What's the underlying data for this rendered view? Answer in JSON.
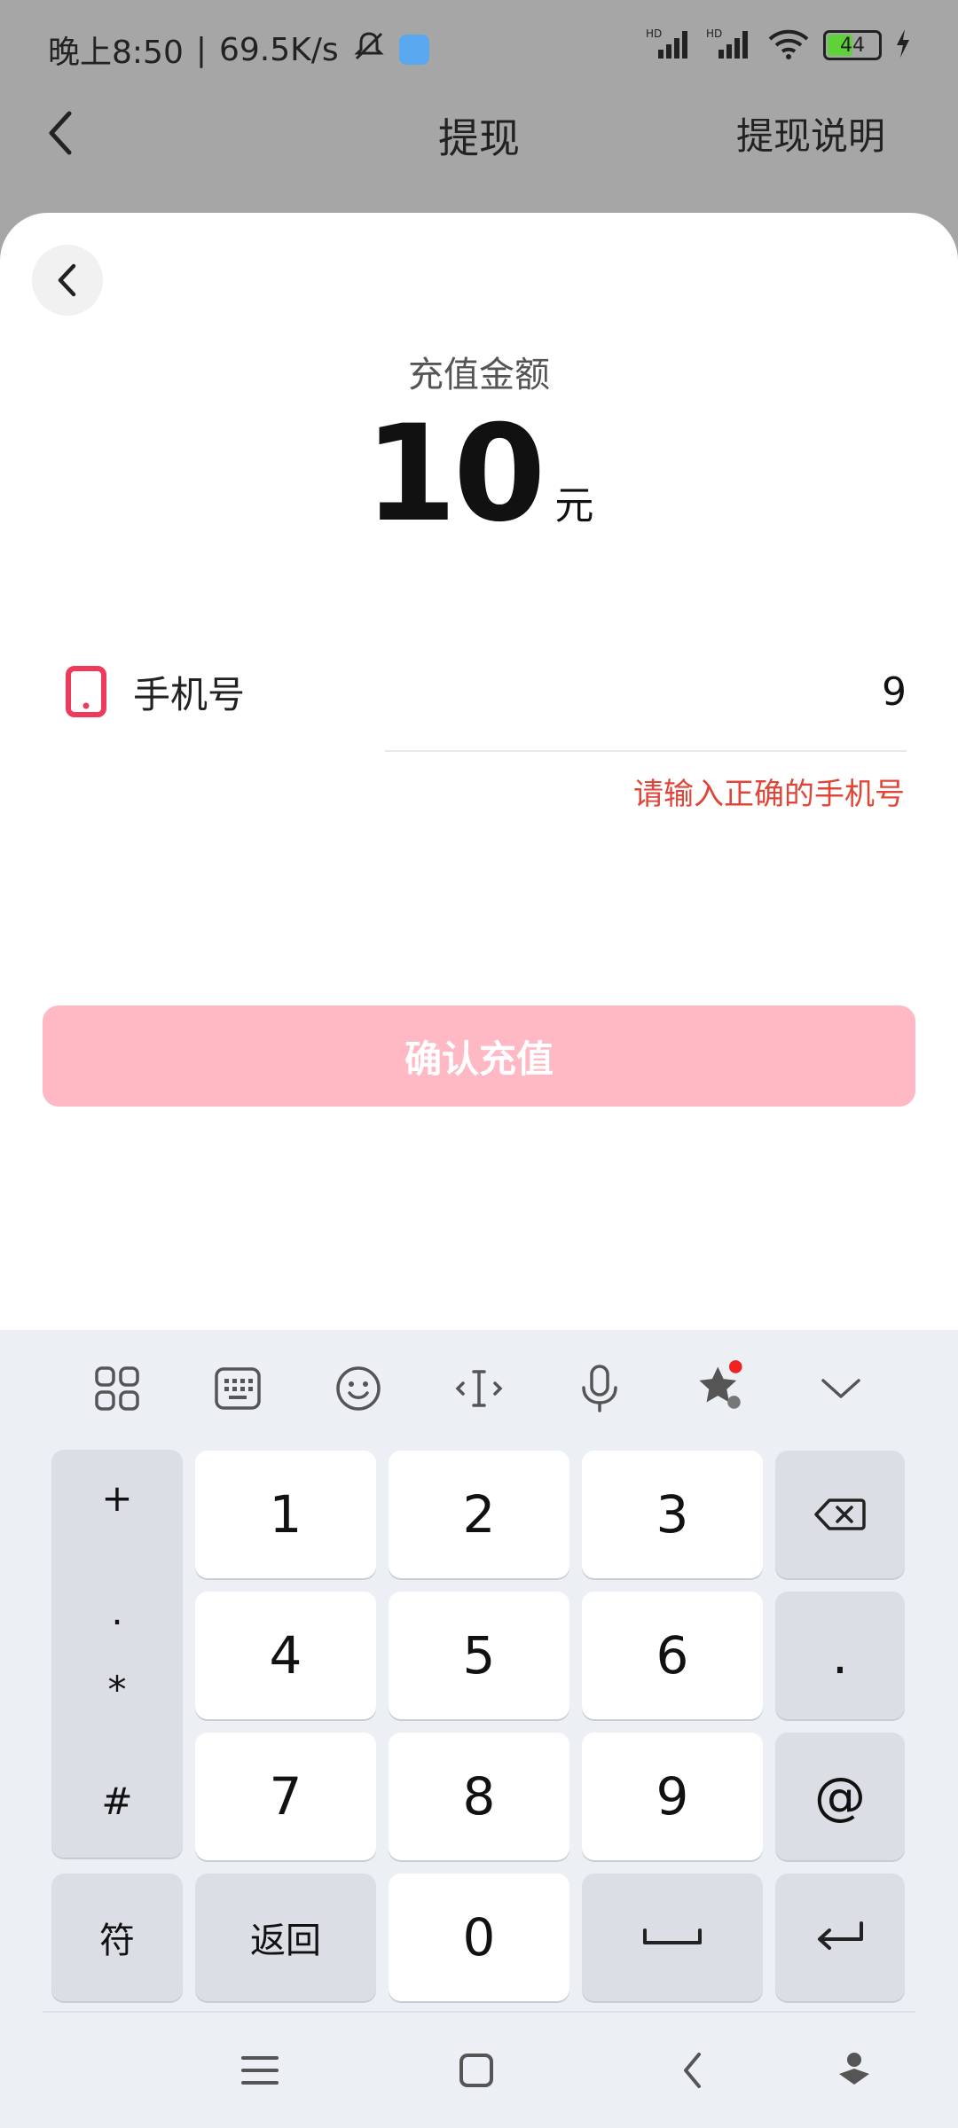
{
  "status_bar": {
    "time_text": "晚上8:50",
    "net_speed": "69.5K/s",
    "battery_level": "44"
  },
  "header": {
    "title": "提现",
    "right_link": "提现说明"
  },
  "sheet": {
    "amount_caption": "充值金额",
    "amount_value": "10",
    "amount_unit": "元",
    "phone_label": "手机号",
    "phone_value": "9",
    "phone_error": "请输入正确的手机号",
    "confirm_label": "确认充值"
  },
  "keyboard": {
    "side_symbols": [
      "+",
      ".",
      "*",
      "#"
    ],
    "keys": [
      "1",
      "2",
      "3",
      "4",
      "5",
      "6",
      "7",
      "8",
      "9",
      "0"
    ],
    "dot_key": ".",
    "at_key": "@",
    "symbols_key": "符",
    "return_key": "返回"
  },
  "colors": {
    "accent_pink": "#ffb9c5",
    "error_red": "#e04538",
    "phone_icon": "#ee3b5b"
  }
}
